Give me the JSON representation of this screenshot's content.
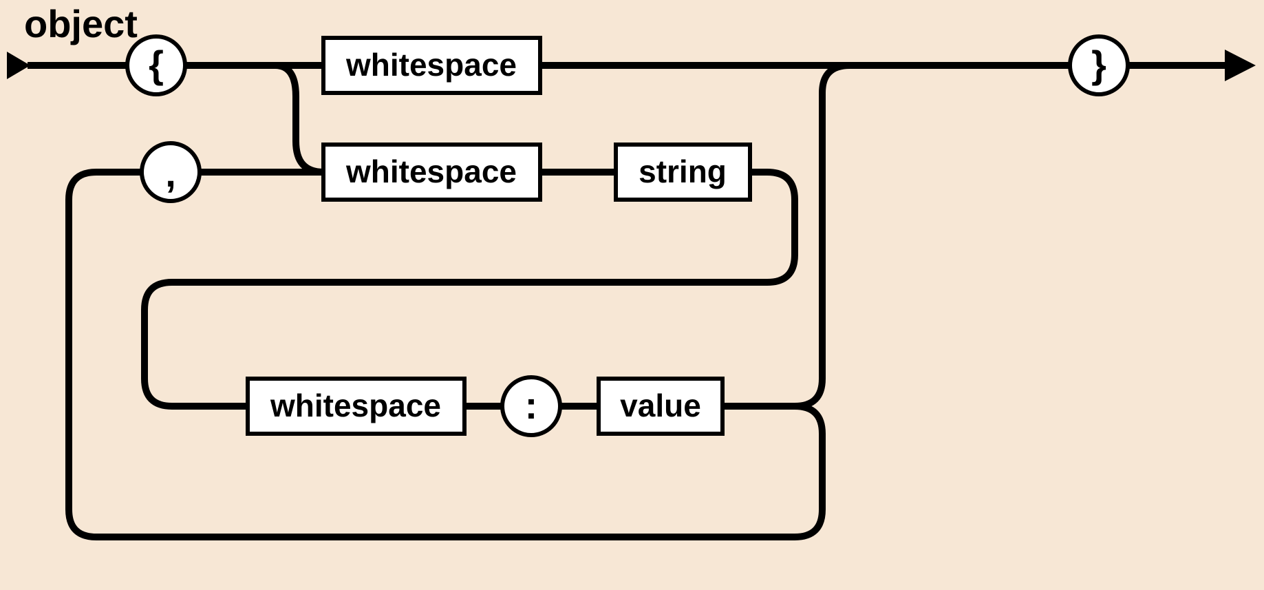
{
  "title": "object",
  "terminals": {
    "open_brace": "{",
    "close_brace": "}",
    "comma": ",",
    "colon": ":"
  },
  "nonterminals": {
    "whitespace1": "whitespace",
    "whitespace2": "whitespace",
    "whitespace3": "whitespace",
    "string": "string",
    "value": "value"
  }
}
